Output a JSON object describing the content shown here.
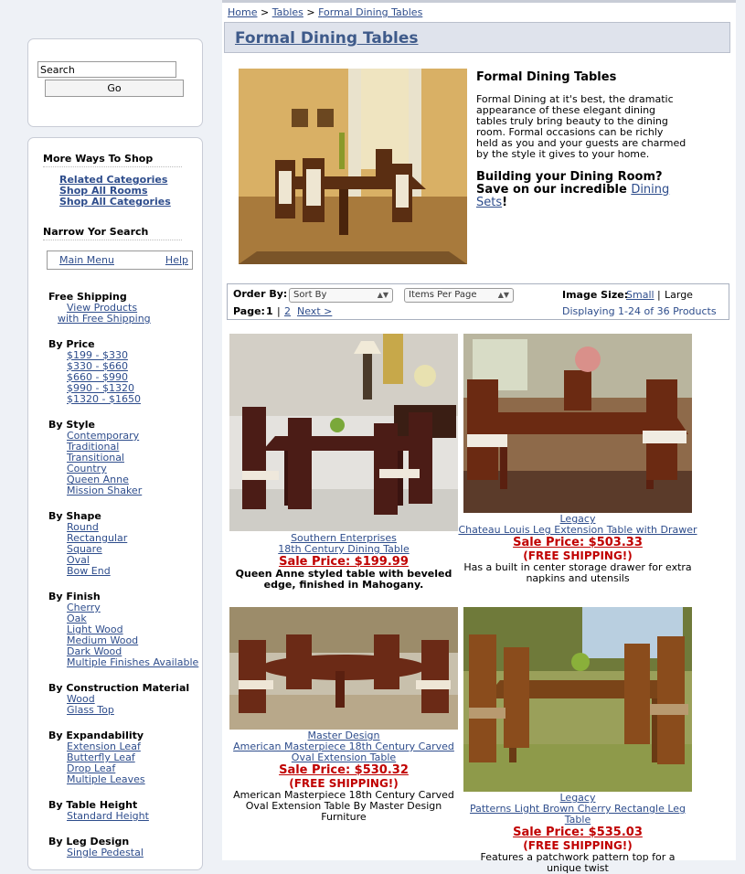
{
  "breadcrumb": {
    "home": "Home",
    "sep1": ">",
    "tables": "Tables",
    "sep2": ">",
    "current": "Formal Dining Tables"
  },
  "page_title": "Formal Dining Tables",
  "search": {
    "value": "Search",
    "go": "Go"
  },
  "sidebar": {
    "more_ways": "More Ways To Shop",
    "links": [
      "Related Categories",
      "Shop All Rooms",
      "Shop All Categories"
    ],
    "narrow": "Narrow Yor Search",
    "main_menu": "Main Menu",
    "help": "Help",
    "free_shipping": {
      "title": "Free Shipping",
      "items": [
        "View Products",
        "with Free Shipping"
      ]
    },
    "groups": [
      {
        "title": "By Price",
        "items": [
          "$199 - $330",
          "$330 - $660",
          "$660 - $990",
          "$990 - $1320",
          "$1320 - $1650"
        ]
      },
      {
        "title": "By Style",
        "items": [
          "Contemporary",
          "Traditional",
          "Transitional",
          "Country",
          "Queen Anne",
          "Mission Shaker"
        ]
      },
      {
        "title": "By Shape",
        "items": [
          "Round",
          "Rectangular",
          "Square",
          "Oval",
          "Bow End"
        ]
      },
      {
        "title": "By Finish",
        "items": [
          "Cherry",
          "Oak",
          "Light Wood",
          "Medium Wood",
          "Dark Wood",
          "Multiple Finishes Available"
        ]
      },
      {
        "title": "By Construction Material",
        "items": [
          "Wood",
          "Glass Top"
        ]
      },
      {
        "title": "By Expandability",
        "items": [
          "Extension Leaf",
          "Butterfly Leaf",
          "Drop Leaf",
          "Multiple Leaves"
        ]
      },
      {
        "title": "By Table Height",
        "items": [
          "Standard Height"
        ]
      },
      {
        "title": "By Leg Design",
        "items": [
          "Single Pedestal"
        ]
      }
    ]
  },
  "intro": {
    "heading": "Formal Dining Tables",
    "text": "Formal Dining at it's best, the dramatic appearance of these elegant dining tables truly bring beauty to the dining room. Formal occasions can be richly held as you and your guests are charmed by the style it gives to your home.",
    "building_1": "Building your Dining Room?",
    "building_2": "Save on our incredible",
    "building_link": "Dining Sets",
    "building_end": "!"
  },
  "sortbar": {
    "order_by": "Order By:",
    "sort_by": "Sort By",
    "items_per_page": "Items Per Page",
    "image_size": "Image Size:",
    "small": "Small",
    "size_sep": "|",
    "large": "Large",
    "page_label": "Page:",
    "page1": "1",
    "page_sep": "|",
    "page2": "2",
    "next": "Next >",
    "displaying": "Displaying 1-24 of 36 Products"
  },
  "products": [
    {
      "manufacturer": "Southern Enterprises",
      "name": "18th Century Dining Table",
      "price": "Sale Price: $199.99",
      "shipping": "",
      "description": "Queen Anne styled table with beveled edge, finished in Mahogany."
    },
    {
      "manufacturer": "Legacy",
      "name": "Chateau Louis Leg Extension Table with Drawer",
      "price": "Sale Price: $503.33",
      "shipping": "(FREE SHIPPING!)",
      "description": "Has a built in center storage drawer for extra napkins and utensils"
    },
    {
      "manufacturer": "Master Design",
      "name": "American Masterpiece 18th Century Carved Oval Extension Table",
      "price": "Sale Price: $530.32",
      "shipping": "(FREE SHIPPING!)",
      "description": "American Masterpiece 18th Century Carved Oval Extension Table By Master Design Furniture"
    },
    {
      "manufacturer": "Legacy",
      "name": "Patterns Light Brown Cherry Rectangle Leg Table",
      "price": "Sale Price: $535.03",
      "shipping": "(FREE SHIPPING!)",
      "description": "Features a patchwork pattern top for a unique twist"
    }
  ]
}
